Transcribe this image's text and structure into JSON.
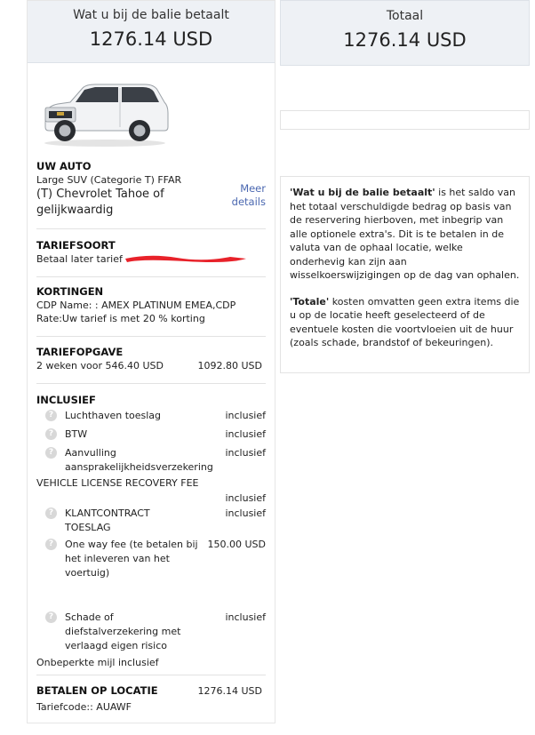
{
  "left_price": {
    "label": "Wat u bij de balie betaalt",
    "amount": "1276.14 USD"
  },
  "right_price": {
    "label": "Totaal",
    "amount": "1276.14 USD"
  },
  "car": {
    "section_title": "UW AUTO",
    "category": "Large SUV (Categorie T) FFAR",
    "name": "(T) Chevrolet Tahoe of gelijkwaardig",
    "more_link": "Meer details"
  },
  "rate_type": {
    "title": "TARIEFSOORT",
    "value": "Betaal later tarief - "
  },
  "discounts": {
    "title": "KORTINGEN",
    "cdp": "CDP Name: : AMEX PLATINUM EMEA,CDP",
    "rate": "Rate:Uw tarief is met 20 % korting"
  },
  "rate_spec": {
    "title": "TARIEFOPGAVE",
    "desc": "2 weken voor 546.40 USD",
    "amount": "1092.80 USD"
  },
  "included": {
    "title": "INCLUSIEF",
    "items": [
      {
        "label": "Luchthaven toeslag",
        "value": "inclusief"
      },
      {
        "label": "BTW",
        "value": "inclusief"
      },
      {
        "label": "Aanvulling aansprakelijkheidsverzekering",
        "value": "inclusief"
      },
      {
        "label": "VEHICLE LICENSE RECOVERY FEE",
        "value": "inclusief"
      },
      {
        "label": "KLANTCONTRACT TOESLAG",
        "value": "inclusief"
      },
      {
        "label": "One way fee (te betalen bij het inleveren van het voertuig)",
        "value": "150.00 USD"
      },
      {
        "label": "Schade of diefstalverzekering met verlaagd eigen risico",
        "value": "inclusief"
      }
    ],
    "mileage": "Onbeperkte mijl inclusief"
  },
  "pay_at_location": {
    "title": "BETALEN OP LOCATIE",
    "amount": "1276.14 USD",
    "rate_code": "Tariefcode:: AUAWF"
  },
  "info": {
    "p1_bold": "'Wat u bij de balie betaalt'",
    "p1_text": " is het saldo van het totaal verschuldigde bedrag op basis van de reservering hierboven, met inbegrip van alle optionele extra's. Dit is te betalen in de valuta van de ophaal locatie, welke onderhevig kan zijn aan wisselkoerswijzigingen op de dag van ophalen.",
    "p2_bold": "'Totale'",
    "p2_text": " kosten omvatten geen extra items die u op de locatie heeft geselecteerd of de eventuele kosten die voortvloeien uit de huur (zoals schade, brandstof of bekeuringen)."
  },
  "icons": {
    "help": "question-circle-icon"
  }
}
